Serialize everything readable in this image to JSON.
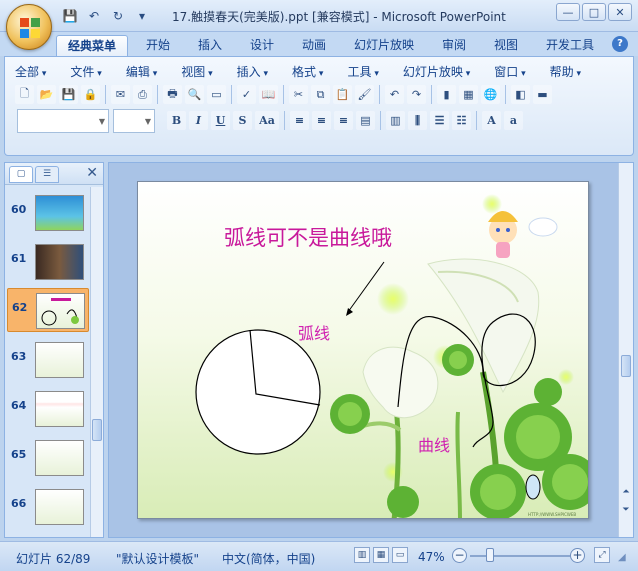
{
  "window": {
    "title": "17.触摸春天(完美版).ppt [兼容模式] - Microsoft PowerPoint",
    "controls": [
      "—",
      "□",
      "✕"
    ]
  },
  "qat": {
    "icons": [
      "save-icon",
      "undo-icon",
      "redo-icon",
      "customize-qat-icon"
    ]
  },
  "ribbon_tabs": [
    {
      "label": "经典菜单",
      "active": true
    },
    {
      "label": "开始"
    },
    {
      "label": "插入"
    },
    {
      "label": "设计"
    },
    {
      "label": "动画"
    },
    {
      "label": "幻灯片放映"
    },
    {
      "label": "审阅"
    },
    {
      "label": "视图"
    },
    {
      "label": "开发工具"
    }
  ],
  "menus": [
    "全部",
    "文件",
    "编辑",
    "视图",
    "插入",
    "格式",
    "工具",
    "幻灯片放映",
    "窗口",
    "帮助"
  ],
  "format_buttons": [
    "B",
    "I",
    "U",
    "S",
    "Aa"
  ],
  "slides_panel": {
    "tabs": [
      "slides-tab",
      "outline-tab"
    ],
    "close": "✕",
    "thumbs": [
      {
        "num": "60",
        "selected": false
      },
      {
        "num": "61",
        "selected": false
      },
      {
        "num": "62",
        "selected": true
      },
      {
        "num": "63",
        "selected": false
      },
      {
        "num": "64",
        "selected": false
      },
      {
        "num": "65",
        "selected": false
      },
      {
        "num": "66",
        "selected": false
      }
    ]
  },
  "slide": {
    "heading": "弧线可不是曲线哦",
    "label_arc": "弧线",
    "label_curve": "曲线",
    "footer": "HTTP://WWW.SHPICWEB"
  },
  "status": {
    "slide_info": "幻灯片 62/89",
    "template": "\"默认设计模板\"",
    "language": "中文(简体，中国)",
    "zoom": "47%",
    "zoom_minus": "−",
    "zoom_plus": "+"
  },
  "colors": {
    "heading": "#c8199b",
    "label": "#d020b0",
    "selected_thumb": "#f8b46a"
  }
}
